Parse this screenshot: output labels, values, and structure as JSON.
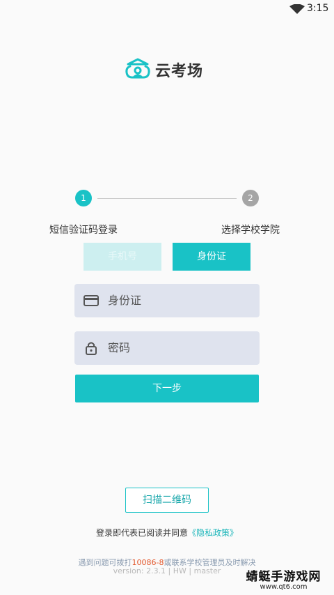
{
  "status_bar": {
    "time": "3:15",
    "wifi_icon": "wifi-icon"
  },
  "brand": {
    "name": "云考场",
    "logo_icon": "cloud-exam-logo-icon",
    "color": "#19c2c6"
  },
  "steps": [
    {
      "number": "1",
      "label": "短信验证码登录",
      "active": true
    },
    {
      "number": "2",
      "label": "选择学校学院",
      "active": false
    }
  ],
  "login_tabs": [
    {
      "label": "手机号",
      "selected": false
    },
    {
      "label": "身份证",
      "selected": true
    }
  ],
  "fields": {
    "id": {
      "placeholder": "身份证",
      "icon": "id-card-icon"
    },
    "password": {
      "placeholder": "密码",
      "icon": "lock-icon"
    }
  },
  "next_button": {
    "label": "下一步"
  },
  "scan_button": {
    "label": "扫描二维码"
  },
  "agreement": {
    "text": "登录即代表已阅读并同意",
    "link": "《隐私政策》"
  },
  "help": {
    "prefix": "遇到问题可拨打",
    "phone": "10086-8",
    "suffix": "或联系学校管理员及时解决"
  },
  "version": "version: 2.3.1 | HW | master",
  "watermark": {
    "title": "蜻蜓手游戏网",
    "url": "www.qt6.com"
  },
  "colors": {
    "accent": "#19c2c6",
    "accent_light": "#cdeff0",
    "input_bg": "#dfe3ee",
    "phone_highlight": "#e2572b"
  }
}
